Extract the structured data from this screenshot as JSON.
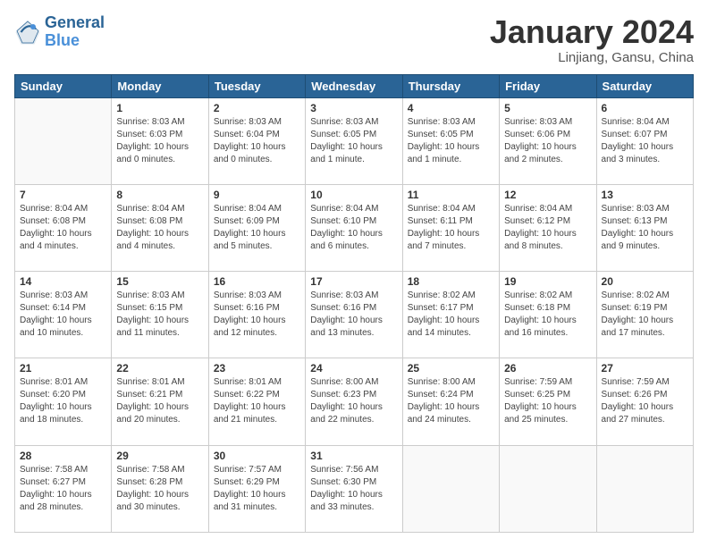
{
  "header": {
    "logo_line1": "General",
    "logo_line2": "Blue",
    "month": "January 2024",
    "location": "Linjiang, Gansu, China"
  },
  "weekdays": [
    "Sunday",
    "Monday",
    "Tuesday",
    "Wednesday",
    "Thursday",
    "Friday",
    "Saturday"
  ],
  "weeks": [
    [
      {
        "day": null
      },
      {
        "day": 1,
        "sunrise": "8:03 AM",
        "sunset": "6:03 PM",
        "daylight": "10 hours and 0 minutes."
      },
      {
        "day": 2,
        "sunrise": "8:03 AM",
        "sunset": "6:04 PM",
        "daylight": "10 hours and 0 minutes."
      },
      {
        "day": 3,
        "sunrise": "8:03 AM",
        "sunset": "6:05 PM",
        "daylight": "10 hours and 1 minute."
      },
      {
        "day": 4,
        "sunrise": "8:03 AM",
        "sunset": "6:05 PM",
        "daylight": "10 hours and 1 minute."
      },
      {
        "day": 5,
        "sunrise": "8:03 AM",
        "sunset": "6:06 PM",
        "daylight": "10 hours and 2 minutes."
      },
      {
        "day": 6,
        "sunrise": "8:04 AM",
        "sunset": "6:07 PM",
        "daylight": "10 hours and 3 minutes."
      }
    ],
    [
      {
        "day": 7,
        "sunrise": "8:04 AM",
        "sunset": "6:08 PM",
        "daylight": "10 hours and 4 minutes."
      },
      {
        "day": 8,
        "sunrise": "8:04 AM",
        "sunset": "6:08 PM",
        "daylight": "10 hours and 4 minutes."
      },
      {
        "day": 9,
        "sunrise": "8:04 AM",
        "sunset": "6:09 PM",
        "daylight": "10 hours and 5 minutes."
      },
      {
        "day": 10,
        "sunrise": "8:04 AM",
        "sunset": "6:10 PM",
        "daylight": "10 hours and 6 minutes."
      },
      {
        "day": 11,
        "sunrise": "8:04 AM",
        "sunset": "6:11 PM",
        "daylight": "10 hours and 7 minutes."
      },
      {
        "day": 12,
        "sunrise": "8:04 AM",
        "sunset": "6:12 PM",
        "daylight": "10 hours and 8 minutes."
      },
      {
        "day": 13,
        "sunrise": "8:03 AM",
        "sunset": "6:13 PM",
        "daylight": "10 hours and 9 minutes."
      }
    ],
    [
      {
        "day": 14,
        "sunrise": "8:03 AM",
        "sunset": "6:14 PM",
        "daylight": "10 hours and 10 minutes."
      },
      {
        "day": 15,
        "sunrise": "8:03 AM",
        "sunset": "6:15 PM",
        "daylight": "10 hours and 11 minutes."
      },
      {
        "day": 16,
        "sunrise": "8:03 AM",
        "sunset": "6:16 PM",
        "daylight": "10 hours and 12 minutes."
      },
      {
        "day": 17,
        "sunrise": "8:03 AM",
        "sunset": "6:16 PM",
        "daylight": "10 hours and 13 minutes."
      },
      {
        "day": 18,
        "sunrise": "8:02 AM",
        "sunset": "6:17 PM",
        "daylight": "10 hours and 14 minutes."
      },
      {
        "day": 19,
        "sunrise": "8:02 AM",
        "sunset": "6:18 PM",
        "daylight": "10 hours and 16 minutes."
      },
      {
        "day": 20,
        "sunrise": "8:02 AM",
        "sunset": "6:19 PM",
        "daylight": "10 hours and 17 minutes."
      }
    ],
    [
      {
        "day": 21,
        "sunrise": "8:01 AM",
        "sunset": "6:20 PM",
        "daylight": "10 hours and 18 minutes."
      },
      {
        "day": 22,
        "sunrise": "8:01 AM",
        "sunset": "6:21 PM",
        "daylight": "10 hours and 20 minutes."
      },
      {
        "day": 23,
        "sunrise": "8:01 AM",
        "sunset": "6:22 PM",
        "daylight": "10 hours and 21 minutes."
      },
      {
        "day": 24,
        "sunrise": "8:00 AM",
        "sunset": "6:23 PM",
        "daylight": "10 hours and 22 minutes."
      },
      {
        "day": 25,
        "sunrise": "8:00 AM",
        "sunset": "6:24 PM",
        "daylight": "10 hours and 24 minutes."
      },
      {
        "day": 26,
        "sunrise": "7:59 AM",
        "sunset": "6:25 PM",
        "daylight": "10 hours and 25 minutes."
      },
      {
        "day": 27,
        "sunrise": "7:59 AM",
        "sunset": "6:26 PM",
        "daylight": "10 hours and 27 minutes."
      }
    ],
    [
      {
        "day": 28,
        "sunrise": "7:58 AM",
        "sunset": "6:27 PM",
        "daylight": "10 hours and 28 minutes."
      },
      {
        "day": 29,
        "sunrise": "7:58 AM",
        "sunset": "6:28 PM",
        "daylight": "10 hours and 30 minutes."
      },
      {
        "day": 30,
        "sunrise": "7:57 AM",
        "sunset": "6:29 PM",
        "daylight": "10 hours and 31 minutes."
      },
      {
        "day": 31,
        "sunrise": "7:56 AM",
        "sunset": "6:30 PM",
        "daylight": "10 hours and 33 minutes."
      },
      {
        "day": null
      },
      {
        "day": null
      },
      {
        "day": null
      }
    ]
  ]
}
